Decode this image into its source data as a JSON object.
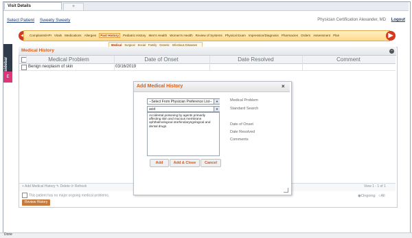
{
  "window": {
    "tab_title": "Visit Details",
    "tab_new": "+"
  },
  "topbar": {
    "select_patient": "Select Patient",
    "patient_name": "Sweety Sweety",
    "right_text": "Physician  Certification Alexander, MD",
    "logout": "Logout"
  },
  "nav": {
    "items": [
      "Complaints/HPI",
      "Vitals",
      "Medications",
      "Allergies",
      "Past History",
      "Pediatric History",
      "Men's Health",
      "Women's Health",
      "Review of Systems",
      "Physical Exam",
      "Impression/Diagnosis",
      "Pharmacies",
      "Orders",
      "Assessment",
      "Plan"
    ],
    "selected": "Past History",
    "subitems": [
      "Medical",
      "Surgical",
      "Social",
      "Family",
      "Genetic",
      "Infectious Diseases"
    ],
    "sub_selected": "Medical",
    "prev_icon": "left-arrow-icon",
    "next_icon": "right-arrow-icon"
  },
  "sidebar": {
    "tab_label": "sidebar",
    "tab2_label": "E"
  },
  "panel": {
    "title": "Medical History",
    "columns": [
      "Medical Problem",
      "Date of Onset",
      "Date Resolved",
      "Comment"
    ],
    "rows": [
      {
        "problem": "Benign neoplasm of skin",
        "onset": "03/16/2019",
        "resolved": "",
        "comment": ""
      }
    ],
    "pager_actions": "+ Add Medical History  ✎ Delete  ⟳ Refresh",
    "pager_right": "View 1 - 1 of 1",
    "no_problems": "This patient has no major ongoing medical problems.",
    "review_button": "Review History",
    "radio_ongoing": "Ongoing",
    "radio_all": "All"
  },
  "modal": {
    "title": "Add Medical History",
    "select_value": "--Select From Physician Preference List--",
    "search_value": "acid",
    "list_items": [
      "Accidental poisoning by agents primarily",
      "affecting skin and mucous membrane",
      "ophthalmological otorhinolaryngological and",
      "dental drugs"
    ],
    "labels": [
      "Medical Problem",
      "Standard Search",
      "Date of Onset",
      "Date Resolved",
      "Comments"
    ],
    "buttons": [
      "Add",
      "Add & Close",
      "Cancel"
    ]
  },
  "status": {
    "text": "Done"
  },
  "colors": {
    "accent_orange": "#e05c10",
    "nav_bg": "#ffd98a",
    "nav_arrow": "#d63a1e",
    "sidebar_dark": "#2e3b4b",
    "sidebar_pink": "#e0357a"
  }
}
